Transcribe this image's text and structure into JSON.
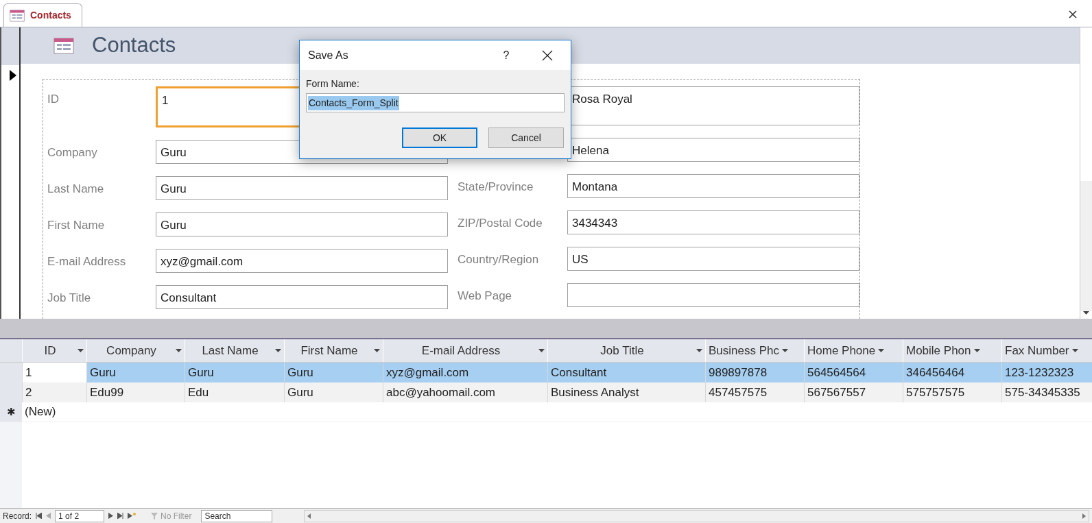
{
  "document_tab": {
    "label": "Contacts",
    "selected": true
  },
  "form_header": {
    "title": "Contacts"
  },
  "form": {
    "left_fields": [
      {
        "label": "ID",
        "value": "1",
        "focused": true
      },
      {
        "label": "Company",
        "value": "Guru",
        "focused": false
      },
      {
        "label": "Last Name",
        "value": "Guru",
        "focused": false
      },
      {
        "label": "First Name",
        "value": "Guru",
        "focused": false
      },
      {
        "label": "E-mail Address",
        "value": "xyz@gmail.com",
        "focused": false
      },
      {
        "label": "Job Title",
        "value": "Consultant",
        "focused": false
      }
    ],
    "right_fields": [
      {
        "value": "Rosa Royal"
      },
      {
        "value": "Helena"
      },
      {
        "label": "State/Province",
        "value": "Montana"
      },
      {
        "label": "ZIP/Postal Code",
        "value": "3434343"
      },
      {
        "label": "Country/Region",
        "value": "US"
      },
      {
        "label": "Web Page"
      }
    ]
  },
  "datasheet": {
    "columns": [
      {
        "label": "ID"
      },
      {
        "label": "Company"
      },
      {
        "label": "Last Name"
      },
      {
        "label": "First Name"
      },
      {
        "label": "E-mail Address"
      },
      {
        "label": "Job Title"
      },
      {
        "label": "Business Phc"
      },
      {
        "label": "Home Phone"
      },
      {
        "label": "Mobile Phon"
      },
      {
        "label": "Fax Number"
      }
    ],
    "rows": [
      {
        "selected": true,
        "cells": [
          "1",
          "Guru",
          "Guru",
          "Guru",
          "xyz@gmail.com",
          "Consultant",
          "989897878",
          "564564564",
          "346456464",
          "123-1232323"
        ]
      },
      {
        "selected": false,
        "cells": [
          "2",
          "Edu99",
          "Edu",
          "Guru",
          "abc@yahoomail.com",
          "Business Analyst",
          "457457575",
          "567567557",
          "575757575",
          "575-34345335"
        ]
      }
    ],
    "new_row": {
      "marker": "✱",
      "label": "(New)"
    }
  },
  "record_nav": {
    "label": "Record:",
    "position": "1 of 2",
    "filter": "No Filter",
    "search_placeholder": "Search"
  },
  "dialog": {
    "title": "Save As",
    "help": "?",
    "field_label": "Form Name:",
    "field_value": "Contacts_Form_Split",
    "buttons": [
      {
        "label": "OK",
        "default": true
      },
      {
        "label": "Cancel",
        "default": false
      }
    ]
  }
}
